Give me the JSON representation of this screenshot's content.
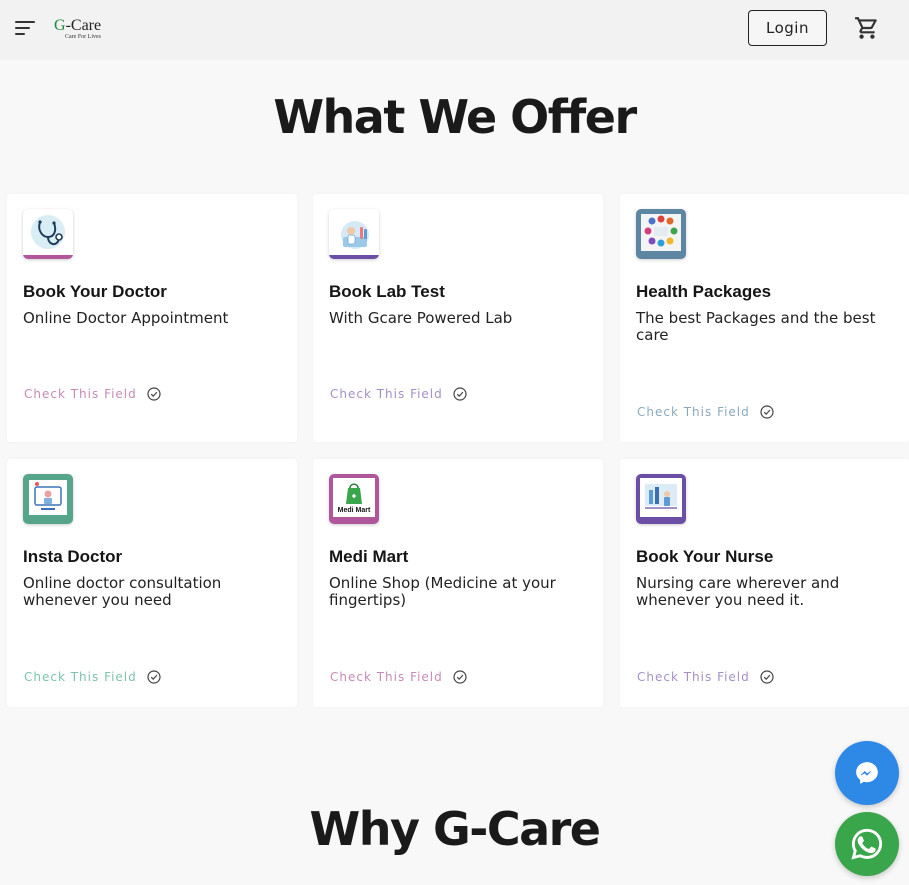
{
  "header": {
    "logo_main": "G-Care",
    "logo_sub": "Care For Lives",
    "login_label": "Login"
  },
  "sections": {
    "offer_title": "What We Offer",
    "why_title": "Why G-Care"
  },
  "cards": [
    {
      "title": "Book Your Doctor",
      "description": "Online Doctor Appointment",
      "link": "Check This Field",
      "accent": "#b0569b",
      "icon": "stethoscope-icon"
    },
    {
      "title": "Book Lab Test",
      "description": "With Gcare Powered Lab",
      "link": "Check This Field",
      "accent": "#6b4fa6",
      "icon": "lab-test-icon"
    },
    {
      "title": "Health Packages",
      "description": "The best Packages and the best care",
      "link": "Check This Field",
      "accent": "#5d86a3",
      "icon": "health-packages-icon"
    },
    {
      "title": "Insta Doctor",
      "description": "Online doctor consultation whenever you need",
      "link": "Check This Field",
      "accent": "#56a58a",
      "icon": "insta-doctor-icon"
    },
    {
      "title": "Medi Mart",
      "description": "Online Shop (Medicine at your fingertips)",
      "link": "Check This Field",
      "accent": "#b0569b",
      "icon": "medi-mart-icon",
      "icon_text": "Medi Mart"
    },
    {
      "title": "Book Your Nurse",
      "description": "Nursing care wherever and whenever you need it.",
      "link": "Check This Field",
      "accent": "#6b4fa6",
      "icon": "nurse-icon"
    }
  ],
  "colors": {
    "link_pink": "#c68bb8",
    "link_purple": "#a590c4",
    "link_blue": "#8aa9bd",
    "link_green": "#7fc2ab",
    "messenger": "#2d88e6",
    "whatsapp": "#3aa64b"
  }
}
